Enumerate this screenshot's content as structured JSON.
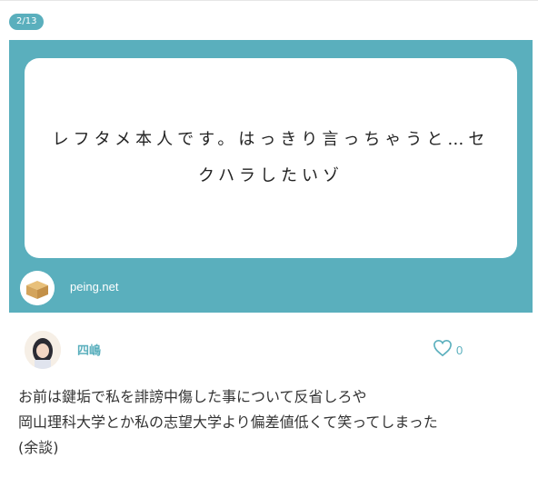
{
  "pagination": {
    "label": "2/13"
  },
  "question": {
    "text": "レフタメ本人です。はっきり言っちゃうと…セクハラしたいゾ"
  },
  "source": {
    "label": "peing.net"
  },
  "answer": {
    "user_name": "四嶋",
    "like_count": "0",
    "lines": [
      "お前は鍵垢で私を誹謗中傷した事について反省しろや",
      "岡山理科大学とか私の志望大学より偏差値低くて笑ってしまった",
      "(余談)"
    ]
  },
  "colors": {
    "accent": "#5aafbd"
  }
}
